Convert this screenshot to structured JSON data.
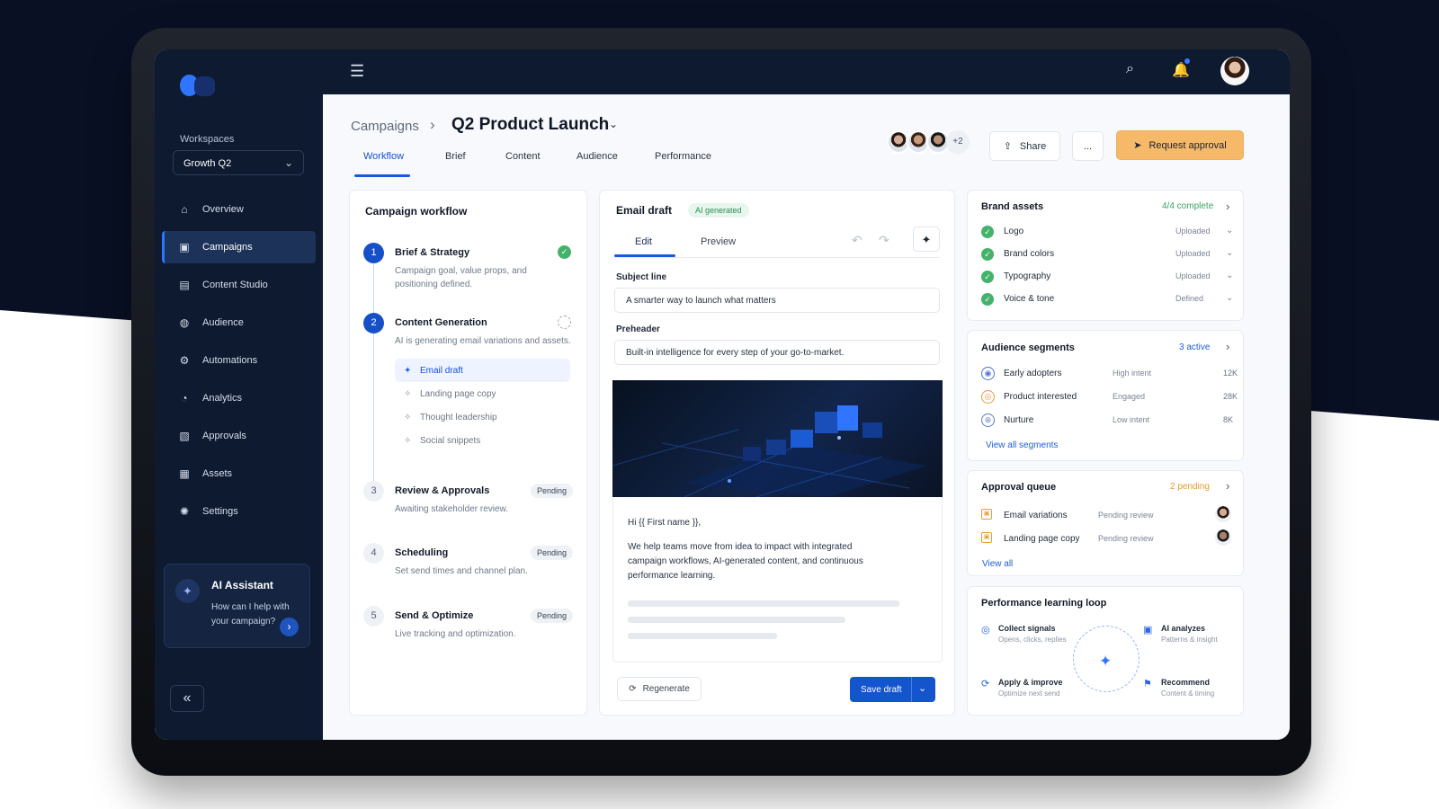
{
  "sidebar": {
    "workspace_label": "Workspaces",
    "workspace_value": "Growth Q2",
    "items": [
      {
        "label": "Overview",
        "icon": "home-icon",
        "active": false
      },
      {
        "label": "Campaigns",
        "icon": "campaigns-icon",
        "active": true
      },
      {
        "label": "Content Studio",
        "icon": "content-studio-icon",
        "active": false
      },
      {
        "label": "Audience",
        "icon": "audience-icon",
        "active": false
      },
      {
        "label": "Automations",
        "icon": "automations-icon",
        "active": false
      },
      {
        "label": "Analytics",
        "icon": "analytics-icon",
        "active": false
      },
      {
        "label": "Approvals",
        "icon": "approvals-icon",
        "active": false
      },
      {
        "label": "Assets",
        "icon": "assets-icon",
        "active": false
      },
      {
        "label": "Settings",
        "icon": "settings-icon",
        "active": false
      }
    ],
    "assistant_title": "AI Assistant",
    "assistant_text": "How can I help with your campaign?"
  },
  "header": {
    "breadcrumb": "Campaigns",
    "title": "Q2 Product Launch",
    "extra_collaborators": "+2",
    "share_label": "Share",
    "more_label": "...",
    "request_label": "Request approval"
  },
  "tabs": [
    "Workflow",
    "Brief",
    "Content",
    "Audience",
    "Performance"
  ],
  "workflow": {
    "title": "Campaign workflow",
    "steps": [
      {
        "num": "1",
        "title": "Brief & Strategy",
        "desc": "Campaign goal, value props, and positioning defined.",
        "status": ""
      },
      {
        "num": "2",
        "title": "Content Generation",
        "desc": "AI is generating email variations and assets.",
        "status": ""
      },
      {
        "num": "3",
        "title": "Review & Approvals",
        "desc": "Awaiting stakeholder review.",
        "status": "Pending"
      },
      {
        "num": "4",
        "title": "Scheduling",
        "desc": "Set send times and channel plan.",
        "status": "Pending"
      },
      {
        "num": "5",
        "title": "Send & Optimize",
        "desc": "Live tracking and optimization.",
        "status": "Pending"
      }
    ],
    "substeps": [
      "Email draft",
      "Landing page copy",
      "Thought leadership",
      "Social snippets"
    ]
  },
  "email": {
    "title": "Email draft",
    "badge": "AI generated",
    "tabs": [
      "Edit",
      "Preview"
    ],
    "subject_label": "Subject line",
    "subject_value": "A smarter way to launch what matters",
    "preheader_label": "Preheader",
    "preheader_value": "Built-in intelligence for every step of your go-to-market.",
    "greeting": "Hi {{ First name }},",
    "body": "We help teams move from idea to impact with integrated campaign workflows, AI-generated content, and continuous performance learning.",
    "regenerate_label": "Regenerate",
    "save_label": "Save draft"
  },
  "brand_assets": {
    "title": "Brand assets",
    "status": "4/4 complete",
    "rows": [
      {
        "name": "Logo",
        "status": "Uploaded"
      },
      {
        "name": "Brand colors",
        "status": "Uploaded"
      },
      {
        "name": "Typography",
        "status": "Uploaded"
      },
      {
        "name": "Voice & tone",
        "status": "Defined"
      }
    ]
  },
  "audience": {
    "title": "Audience segments",
    "status": "3 active",
    "rows": [
      {
        "name": "Early adopters",
        "intent": "High intent",
        "count": "12K",
        "color": "#5073d9"
      },
      {
        "name": "Product interested",
        "intent": "Engaged",
        "count": "28K",
        "color": "#e79b3a"
      },
      {
        "name": "Nurture",
        "intent": "Low intent",
        "count": "8K",
        "color": "#5b7bc9"
      }
    ],
    "link": "View all segments"
  },
  "approval_queue": {
    "title": "Approval queue",
    "status": "2 pending",
    "rows": [
      {
        "name": "Email variations",
        "status": "Pending review"
      },
      {
        "name": "Landing page copy",
        "status": "Pending review"
      }
    ],
    "link": "View all"
  },
  "learning": {
    "title": "Performance learning loop",
    "items": [
      {
        "label": "Collect signals",
        "sub": "Opens, clicks, replies"
      },
      {
        "label": "AI analyzes",
        "sub": "Patterns & insight"
      },
      {
        "label": "Apply & improve",
        "sub": "Optimize next send"
      },
      {
        "label": "Recommend",
        "sub": "Content & timing"
      }
    ]
  },
  "colors": {
    "accent": "#1659e6",
    "nav_dark": "#0d1a30",
    "approval_orange": "#f5b969",
    "success": "#43b36b",
    "pending_orange": "#e99a36"
  }
}
